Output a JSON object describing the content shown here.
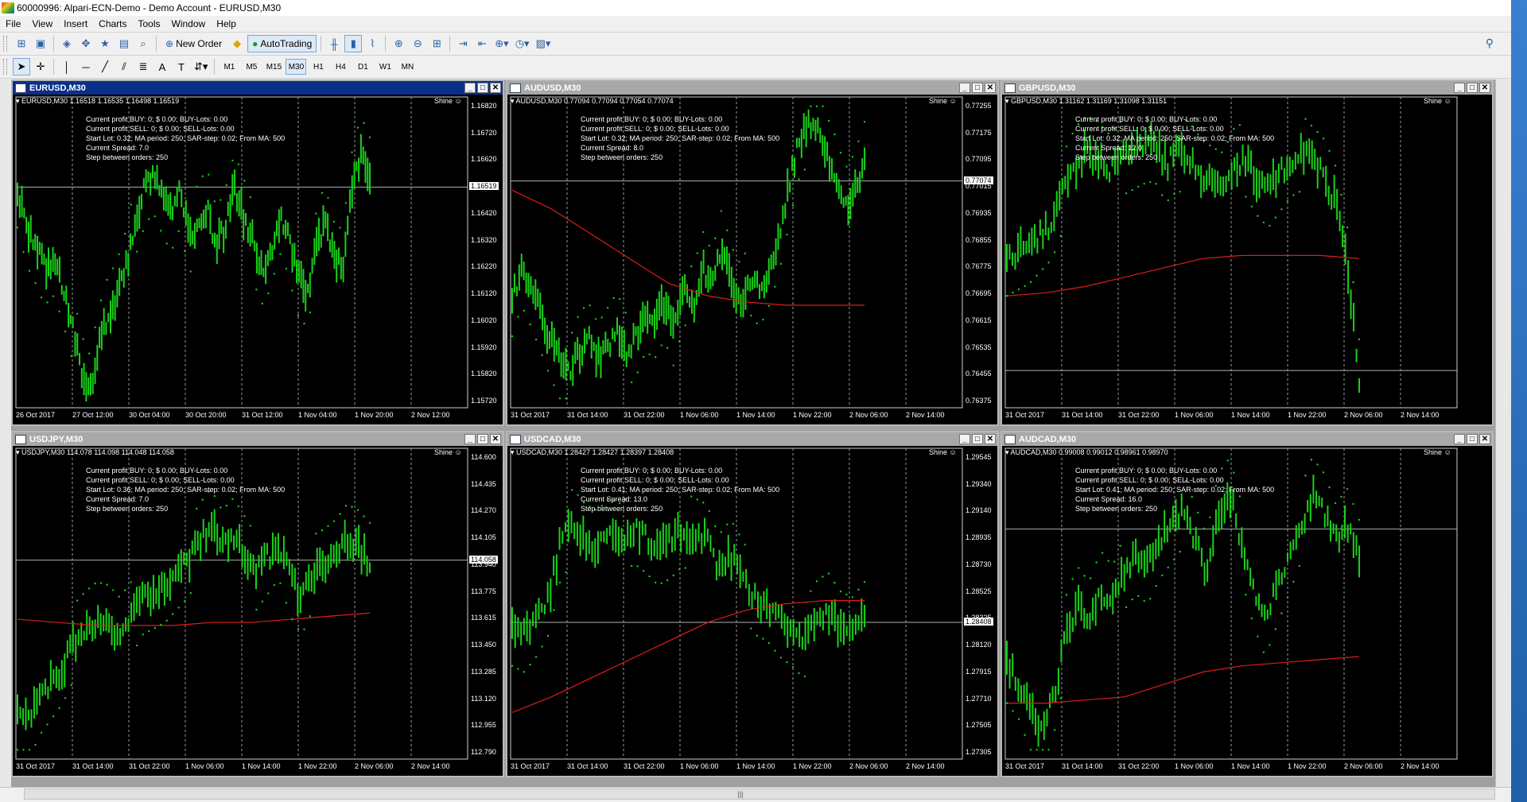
{
  "window": {
    "title": "60000996: Alpari-ECN-Demo - Demo Account - EURUSD,M30"
  },
  "menu": [
    "File",
    "View",
    "Insert",
    "Charts",
    "Tools",
    "Window",
    "Help"
  ],
  "toolbar": {
    "new_order_label": "New Order",
    "autotrading_label": "AutoTrading"
  },
  "timeframes": [
    "M1",
    "M5",
    "M15",
    "M30",
    "H1",
    "H4",
    "D1",
    "W1",
    "MN"
  ],
  "active_timeframe": "M30",
  "colors": {
    "candles": "#19d219",
    "ma": "#e01c1c",
    "sar": "#19d219",
    "background": "#000000",
    "active_title": "#0a2f8a"
  },
  "ea": {
    "name": "Shine"
  },
  "charts": [
    {
      "title": "EURUSD,M30",
      "active": true,
      "info": "EURUSD,M30  1.16518 1.16535 1.16498 1.16519",
      "ea_lines": [
        "Current profit BUY: 0; $ 0.00; BUY-Lots: 0.00",
        "Current profit SELL: 0; $ 0.00; SELL-Lots: 0.00",
        "Start Lot: 0.32;    MA period: 250; SAR-step: 0.02; From MA: 500",
        "Current Spread: 7.0",
        "Step between orders: 250"
      ],
      "prices": [
        "1.16820",
        "1.16720",
        "1.16620",
        "1.16520",
        "1.16420",
        "1.16320",
        "1.16220",
        "1.16120",
        "1.16020",
        "1.15920",
        "1.15820",
        "1.15720"
      ],
      "current": "1.16519",
      "current_frac": 0.29,
      "times": [
        "26 Oct 2017",
        "27 Oct 12:00",
        "30 Oct 04:00",
        "30 Oct 20:00",
        "31 Oct 12:00",
        "1 Nov 04:00",
        "1 Nov 20:00",
        "2 Nov 12:00"
      ],
      "series": [
        0.3,
        0.42,
        0.48,
        0.55,
        0.52,
        0.6,
        0.72,
        0.88,
        0.95,
        0.8,
        0.7,
        0.65,
        0.55,
        0.4,
        0.3,
        0.25,
        0.32,
        0.38,
        0.3,
        0.45,
        0.4,
        0.35,
        0.48,
        0.42,
        0.3,
        0.38,
        0.46,
        0.55,
        0.5,
        0.38,
        0.45,
        0.58,
        0.62,
        0.5,
        0.4,
        0.52,
        0.55,
        0.3,
        0.18,
        0.25
      ],
      "ma": [],
      "sar_start": 0.55
    },
    {
      "title": "AUDUSD,M30",
      "active": false,
      "info": "AUDUSD,M30  0.77094 0.77094 0.77054 0.77074",
      "ea_lines": [
        "Current profit BUY: 0; $ 0.00; BUY-Lots: 0.00",
        "Current profit SELL: 0; $ 0.00; SELL-Lots: 0.00",
        "Start Lot: 0.32;    MA period: 250; SAR-step: 0.02; From MA: 500",
        "Current Spread: 8.0",
        "Step between orders: 250"
      ],
      "prices": [
        "0.77255",
        "0.77175",
        "0.77095",
        "0.77015",
        "0.76935",
        "0.76855",
        "0.76775",
        "0.76695",
        "0.76615",
        "0.76535",
        "0.76455",
        "0.76375"
      ],
      "current": "0.77074",
      "current_frac": 0.27,
      "times": [
        "31 Oct 2017",
        "31 Oct 14:00",
        "31 Oct 22:00",
        "1 Nov 06:00",
        "1 Nov 14:00",
        "1 Nov 22:00",
        "2 Nov 06:00",
        "2 Nov 14:00"
      ],
      "series": [
        0.65,
        0.55,
        0.62,
        0.7,
        0.78,
        0.85,
        0.9,
        0.82,
        0.78,
        0.85,
        0.8,
        0.75,
        0.82,
        0.78,
        0.7,
        0.72,
        0.66,
        0.75,
        0.6,
        0.68,
        0.55,
        0.62,
        0.48,
        0.6,
        0.66,
        0.58,
        0.62,
        0.55,
        0.45,
        0.3,
        0.15,
        0.1,
        0.08,
        0.18,
        0.25,
        0.35,
        0.3,
        0.2
      ],
      "ma": [
        0.3,
        0.36,
        0.44,
        0.52,
        0.6,
        0.64,
        0.66,
        0.67,
        0.67,
        0.67
      ],
      "sar_start": 0.85
    },
    {
      "title": "GBPUSD,M30",
      "active": false,
      "info": "GBPUSD,M30  1.31162 1.31169 1.31098 1.31151",
      "ea_lines": [
        "Current profit BUY: 0; $ 0.00; BUY-Lots: 0.00",
        "Current profit SELL: 0; $ 0.00; SELL-Lots: 0.00",
        "Start Lot: 0.32;    MA period: 250; SAR-step: 0.02; From MA: 500",
        "Current Spread: 12.0",
        "Step between orders: 250"
      ],
      "prices": [],
      "current": "",
      "current_frac": 0.88,
      "times": [
        "31 Oct 2017",
        "31 Oct 14:00",
        "31 Oct 22:00",
        "1 Nov 06:00",
        "1 Nov 14:00",
        "1 Nov 22:00",
        "2 Nov 06:00",
        "2 Nov 14:00"
      ],
      "series": [
        0.52,
        0.5,
        0.48,
        0.44,
        0.4,
        0.3,
        0.22,
        0.18,
        0.2,
        0.24,
        0.2,
        0.18,
        0.16,
        0.15,
        0.22,
        0.18,
        0.2,
        0.25,
        0.28,
        0.3,
        0.22,
        0.2,
        0.26,
        0.3,
        0.25,
        0.2,
        0.18,
        0.22,
        0.26,
        0.35,
        0.55,
        0.9
      ],
      "ma": [
        0.64,
        0.63,
        0.61,
        0.58,
        0.55,
        0.52,
        0.51,
        0.51,
        0.51,
        0.52
      ],
      "sar_start": 0.45
    },
    {
      "title": "USDJPY,M30",
      "active": false,
      "info": "USDJPY,M30  114.078 114.098 114.048 114.058",
      "ea_lines": [
        "Current profit BUY: 0; $ 0.00; BUY-Lots: 0.00",
        "Current profit SELL: 0; $ 0.00; SELL-Lots: 0.00",
        "Start Lot: 0.36;    MA period: 250; SAR-step: 0.02; From MA: 500",
        "Current Spread: 7.0",
        "Step between orders: 250"
      ],
      "prices": [
        "114.600",
        "114.435",
        "114.270",
        "114.105",
        "113.940",
        "113.775",
        "113.615",
        "113.450",
        "113.285",
        "113.120",
        "112.955",
        "112.790"
      ],
      "current": "114.058",
      "current_frac": 0.36,
      "times": [
        "31 Oct 2017",
        "31 Oct 14:00",
        "31 Oct 22:00",
        "1 Nov 06:00",
        "1 Nov 14:00",
        "1 Nov 22:00",
        "2 Nov 06:00",
        "2 Nov 14:00"
      ],
      "series": [
        0.85,
        0.88,
        0.8,
        0.75,
        0.7,
        0.62,
        0.58,
        0.55,
        0.56,
        0.6,
        0.55,
        0.48,
        0.46,
        0.44,
        0.4,
        0.36,
        0.3,
        0.25,
        0.32,
        0.28,
        0.34,
        0.4,
        0.35,
        0.3,
        0.42,
        0.48,
        0.4,
        0.38,
        0.35,
        0.3,
        0.32,
        0.36
      ],
      "ma": [
        0.55,
        0.56,
        0.57,
        0.57,
        0.57,
        0.56,
        0.56,
        0.55,
        0.54,
        0.53
      ],
      "sar_start": 0.4
    },
    {
      "title": "USDCAD,M30",
      "active": false,
      "info": "USDCAD,M30  1.28427 1.28427 1.28397 1.28408",
      "ea_lines": [
        "Current profit BUY: 0; $ 0.00; BUY-Lots: 0.00",
        "Current profit SELL: 0; $ 0.00; SELL-Lots: 0.00",
        "Start Lot: 0.41;    MA period: 250; SAR-step: 0.02; From MA: 500",
        "Current Spread: 13.0",
        "Step between orders: 250"
      ],
      "prices": [
        "1.29545",
        "1.29340",
        "1.29140",
        "1.28935",
        "1.28730",
        "1.28525",
        "1.28325",
        "1.28120",
        "1.27915",
        "1.27710",
        "1.27505",
        "1.27305"
      ],
      "current": "1.28408",
      "current_frac": 0.56,
      "times": [
        "31 Oct 2017",
        "31 Oct 14:00",
        "31 Oct 22:00",
        "1 Nov 06:00",
        "1 Nov 14:00",
        "1 Nov 22:00",
        "2 Nov 06:00",
        "2 Nov 14:00"
      ],
      "series": [
        0.58,
        0.6,
        0.55,
        0.48,
        0.3,
        0.25,
        0.3,
        0.32,
        0.28,
        0.3,
        0.25,
        0.28,
        0.32,
        0.3,
        0.26,
        0.28,
        0.3,
        0.4,
        0.35,
        0.42,
        0.48,
        0.5,
        0.55,
        0.58,
        0.62,
        0.55,
        0.52,
        0.58,
        0.6,
        0.55
      ],
      "ma": [
        0.85,
        0.8,
        0.74,
        0.68,
        0.62,
        0.56,
        0.52,
        0.5,
        0.49,
        0.49
      ],
      "sar_start": 0.25
    },
    {
      "title": "AUDCAD,M30",
      "active": false,
      "info": "AUDCAD,M30  0.99008 0.99012 0.98961 0.98970",
      "ea_lines": [
        "Current profit BUY: 0; $ 0.00; BUY-Lots: 0.00",
        "Current profit SELL: 0; $ 0.00; SELL-Lots: 0.00",
        "Start Lot: 0.41;    MA period: 250; SAR-step: 0.02; From MA: 500",
        "Current Spread: 16.0",
        "Step between orders: 250"
      ],
      "prices": [],
      "current": "",
      "current_frac": 0.26,
      "times": [
        "31 Oct 2017",
        "31 Oct 14:00",
        "31 Oct 22:00",
        "1 Nov 06:00",
        "1 Nov 14:00",
        "1 Nov 22:00",
        "2 Nov 06:00",
        "2 Nov 14:00"
      ],
      "series": [
        0.7,
        0.75,
        0.85,
        0.92,
        0.8,
        0.6,
        0.5,
        0.55,
        0.45,
        0.5,
        0.4,
        0.35,
        0.38,
        0.3,
        0.25,
        0.2,
        0.3,
        0.4,
        0.2,
        0.15,
        0.3,
        0.45,
        0.55,
        0.45,
        0.35,
        0.25,
        0.15,
        0.2,
        0.3,
        0.25,
        0.35
      ],
      "ma": [
        0.82,
        0.82,
        0.81,
        0.8,
        0.76,
        0.72,
        0.7,
        0.69,
        0.68,
        0.67
      ],
      "sar_start": 0.95
    }
  ]
}
